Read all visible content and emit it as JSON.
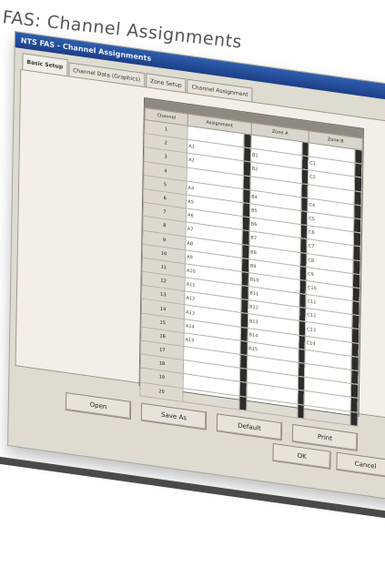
{
  "caption": "FAS: Channel Assignments",
  "window": {
    "title": "NTS FAS - Channel Assignments"
  },
  "tabs": [
    "Basic Setup",
    "Channel Data (Graphics)",
    "Zone Setup",
    "Channel Assignment"
  ],
  "grid": {
    "columns": [
      "Channel",
      "Assignment",
      "Zone A",
      "Zone B"
    ],
    "rows": [
      {
        "ch": "1",
        "a": "",
        "b": "",
        "c": ""
      },
      {
        "ch": "2",
        "a": "A1",
        "b": "B1",
        "c": "C1"
      },
      {
        "ch": "3",
        "a": "A2",
        "b": "B2",
        "c": "C2"
      },
      {
        "ch": "4",
        "a": "",
        "b": "",
        "c": ""
      },
      {
        "ch": "5",
        "a": "A4",
        "b": "B4",
        "c": "C4"
      },
      {
        "ch": "6",
        "a": "A5",
        "b": "B5",
        "c": "C5"
      },
      {
        "ch": "7",
        "a": "A6",
        "b": "B6",
        "c": "C6"
      },
      {
        "ch": "8",
        "a": "A7",
        "b": "B7",
        "c": "C7"
      },
      {
        "ch": "9",
        "a": "A8",
        "b": "B8",
        "c": "C8"
      },
      {
        "ch": "10",
        "a": "A9",
        "b": "B9",
        "c": "C9"
      },
      {
        "ch": "11",
        "a": "A10",
        "b": "B10",
        "c": "C10"
      },
      {
        "ch": "12",
        "a": "A11",
        "b": "B11",
        "c": "C11"
      },
      {
        "ch": "13",
        "a": "A12",
        "b": "B12",
        "c": "C12"
      },
      {
        "ch": "14",
        "a": "A13",
        "b": "B13",
        "c": "C13"
      },
      {
        "ch": "15",
        "a": "A14",
        "b": "B14",
        "c": "C14"
      },
      {
        "ch": "16",
        "a": "A15",
        "b": "B15",
        "c": ""
      },
      {
        "ch": "17",
        "a": "",
        "b": "",
        "c": ""
      },
      {
        "ch": "18",
        "a": "",
        "b": "",
        "c": ""
      },
      {
        "ch": "19",
        "a": "",
        "b": "",
        "c": ""
      },
      {
        "ch": "20",
        "a": "",
        "b": "",
        "c": ""
      }
    ]
  },
  "buttons": {
    "open": "Open",
    "save_as": "Save As",
    "default": "Default",
    "print": "Print",
    "ok": "OK",
    "cancel": "Cancel"
  }
}
